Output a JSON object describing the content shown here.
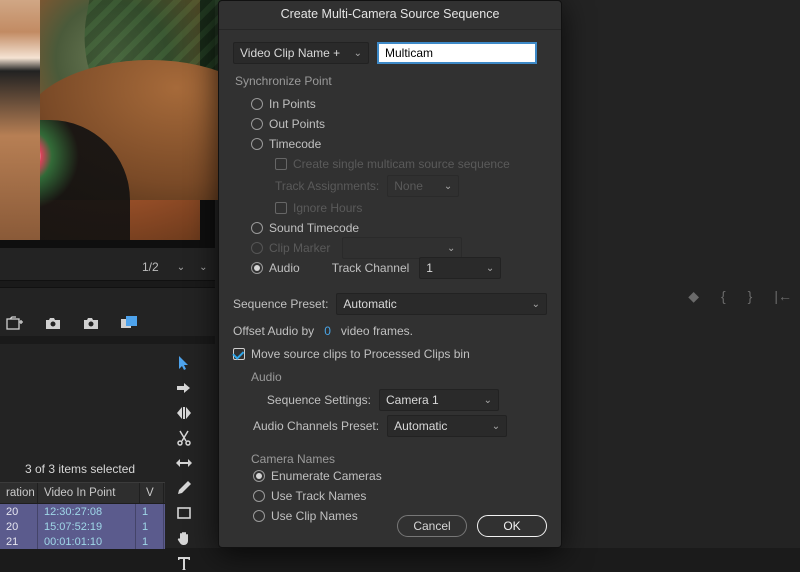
{
  "dialog": {
    "title": "Create Multi-Camera Source Sequence",
    "name_dropdown_label": "Video Clip Name +",
    "name_input_value": "Multicam",
    "sync": {
      "group_title": "Synchronize Point",
      "in_points": "In Points",
      "out_points": "Out Points",
      "timecode": "Timecode",
      "create_single": "Create single multicam source sequence",
      "track_assignments_label": "Track Assignments:",
      "track_assignments_value": "None",
      "ignore_hours": "Ignore Hours",
      "sound_timecode": "Sound Timecode",
      "clip_marker": "Clip Marker",
      "audio": "Audio",
      "track_channel_label": "Track Channel",
      "track_channel_value": "1"
    },
    "sequence_preset_label": "Sequence Preset:",
    "sequence_preset_value": "Automatic",
    "offset_audio_prefix": "Offset Audio by",
    "offset_audio_value": "0",
    "offset_audio_suffix": "video frames.",
    "move_clips": "Move source clips to Processed Clips bin",
    "audio_group": "Audio",
    "sequence_settings_label": "Sequence Settings:",
    "sequence_settings_value": "Camera 1",
    "audio_channels_label": "Audio Channels Preset:",
    "audio_channels_value": "Automatic",
    "camera_names_group": "Camera Names",
    "enumerate": "Enumerate Cameras",
    "use_track": "Use Track Names",
    "use_clip": "Use Clip Names",
    "btn_cancel": "Cancel",
    "btn_ok": "OK"
  },
  "editor": {
    "zoom_value": "1/2",
    "selection_text": "3 of 3 items selected",
    "table_headers": {
      "c1": "ration",
      "c2": "Video In Point",
      "c3": "V"
    },
    "rows": [
      {
        "c1": "20",
        "c2": "12:30:27:08",
        "c3": "1"
      },
      {
        "c1": "20",
        "c2": "15:07:52:19",
        "c3": "1"
      },
      {
        "c1": "21",
        "c2": "00:01:01:10",
        "c3": "1"
      }
    ]
  }
}
